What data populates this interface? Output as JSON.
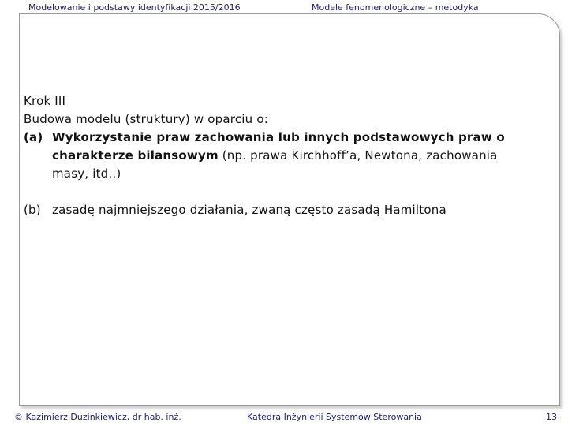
{
  "header": {
    "course": "Modelowanie i podstawy identyfikacji 2015/2016",
    "topic": "Modele fenomenologiczne – metodyka"
  },
  "slide": {
    "step_title": "Krok III",
    "intro": "Budowa modelu (struktury) w oparciu o:",
    "item_a": {
      "marker": "(a)",
      "bold_text": "Wykorzystanie praw zachowania lub innych podstawowych praw o charakterze bilansowym",
      "rest_text": " (np. prawa Kirchhoff’a, Newtona, zachowania masy, itd..)"
    },
    "item_b": {
      "marker": "(b)",
      "text": "zasadę najmniejszego działania, zwaną często zasadą Hamiltona"
    }
  },
  "footer": {
    "author": "© Kazimierz Duzinkiewicz, dr hab. inż.",
    "department": "Katedra Inżynierii Systemów Sterowania",
    "page_number": "13"
  }
}
